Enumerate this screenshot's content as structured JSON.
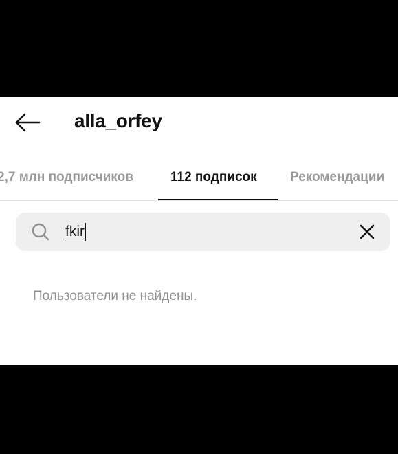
{
  "header": {
    "title": "alla_orfey",
    "back_icon": "arrow-left-icon"
  },
  "tabs": [
    {
      "label": "2,7 млн подписчиков",
      "active": false
    },
    {
      "label": "112 подписок",
      "active": true
    },
    {
      "label": "Рекомендации",
      "active": false
    }
  ],
  "search": {
    "value": "fkir",
    "search_icon": "search-icon",
    "clear_icon": "close-icon"
  },
  "results": {
    "empty_message": "Пользователи не найдены."
  },
  "colors": {
    "background": "#ffffff",
    "text_primary": "#111111",
    "text_secondary": "#8e8e8e",
    "search_bg": "#efefef"
  }
}
